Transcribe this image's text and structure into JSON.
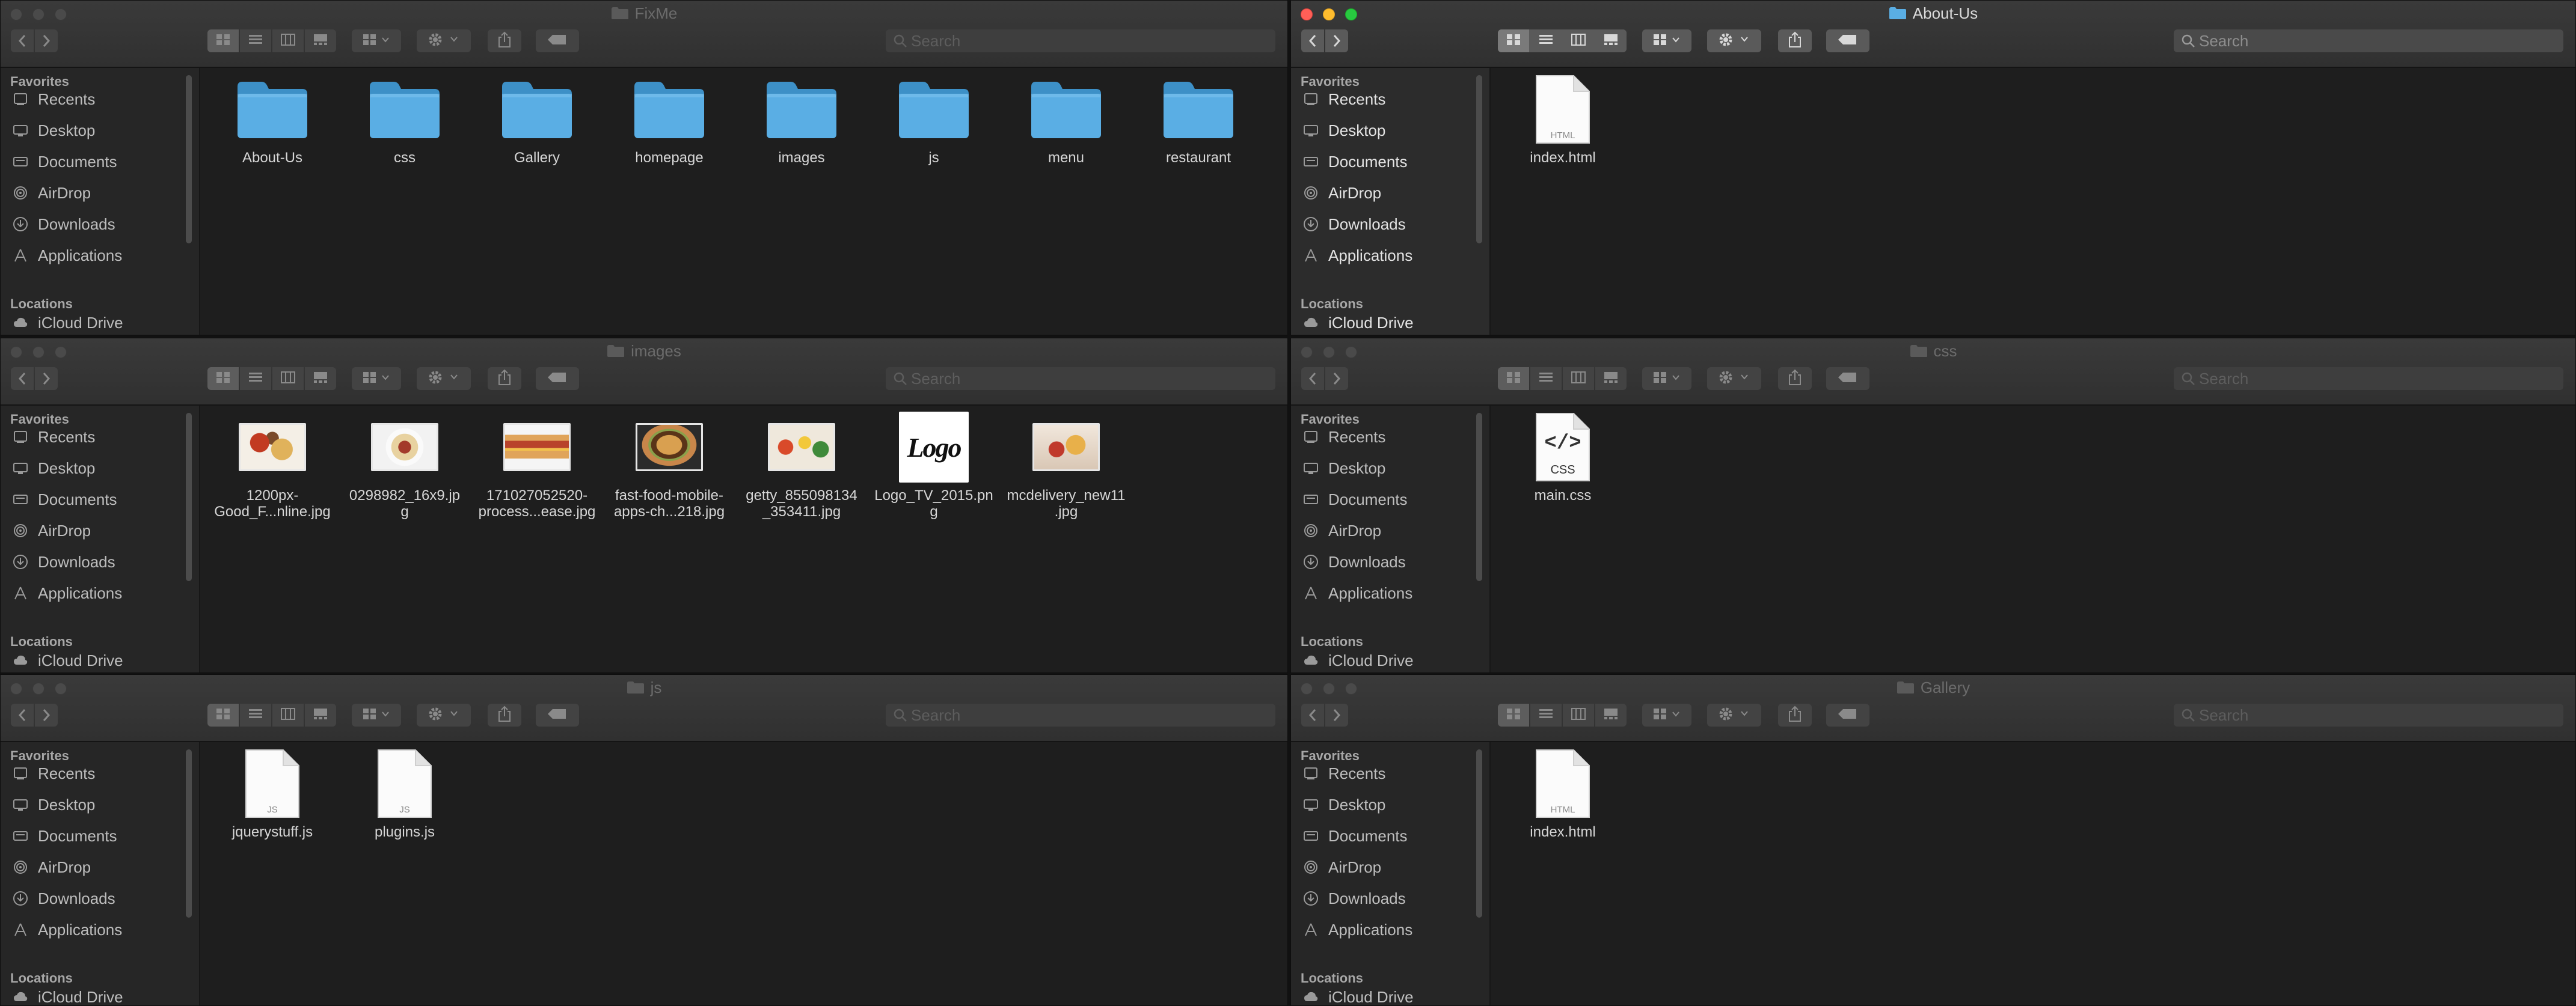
{
  "colors": {
    "folder": "#5aaee4",
    "folder_dark": "#3d90c7",
    "accent_red": "#ff5f57",
    "accent_yellow": "#febc2e",
    "accent_green": "#28c840"
  },
  "sidebar": {
    "favorites_label": "Favorites",
    "locations_label": "Locations",
    "items": [
      {
        "label": "Recents",
        "icon": "recents-icon"
      },
      {
        "label": "Desktop",
        "icon": "desktop-icon"
      },
      {
        "label": "Documents",
        "icon": "documents-icon"
      },
      {
        "label": "AirDrop",
        "icon": "airdrop-icon"
      },
      {
        "label": "Downloads",
        "icon": "downloads-icon"
      },
      {
        "label": "Applications",
        "icon": "applications-icon"
      }
    ],
    "icloud_label": "iCloud Drive"
  },
  "search_placeholder": "Search",
  "windows": [
    {
      "title": "FixMe",
      "active": false,
      "items": [
        {
          "label": "About-Us",
          "kind": "folder"
        },
        {
          "label": "css",
          "kind": "folder"
        },
        {
          "label": "Gallery",
          "kind": "folder"
        },
        {
          "label": "homepage",
          "kind": "folder"
        },
        {
          "label": "images",
          "kind": "folder"
        },
        {
          "label": "js",
          "kind": "folder"
        },
        {
          "label": "menu",
          "kind": "folder"
        },
        {
          "label": "restaurant",
          "kind": "folder"
        }
      ]
    },
    {
      "title": "About-Us",
      "active": true,
      "items": [
        {
          "label": "index.html",
          "kind": "html",
          "badge": "HTML"
        }
      ]
    },
    {
      "title": "images",
      "active": false,
      "items": [
        {
          "label": "1200px-\nGood_F...nline.jpg",
          "kind": "image",
          "thumb": "food-platter"
        },
        {
          "label": "0298982_16x9.jp\ng",
          "kind": "image",
          "thumb": "plate"
        },
        {
          "label": "171027052520-\nprocess...ease.jpg",
          "kind": "image",
          "thumb": "hotdog"
        },
        {
          "label": "fast-food-mobile-\napps-ch...218.jpg",
          "kind": "image",
          "thumb": "burger"
        },
        {
          "label": "getty_855098134\n_353411.jpg",
          "kind": "image",
          "thumb": "spread"
        },
        {
          "label": "Logo_TV_2015.pn\ng",
          "kind": "image",
          "thumb": "logo",
          "logo_text": "Logo"
        },
        {
          "label": "mcdelivery_new11\n.jpg",
          "kind": "image",
          "thumb": "mcdelivery"
        }
      ]
    },
    {
      "title": "css",
      "active": false,
      "items": [
        {
          "label": "main.css",
          "kind": "css",
          "badge": "CSS"
        }
      ]
    },
    {
      "title": "js",
      "active": false,
      "items": [
        {
          "label": "jquerystuff.js",
          "kind": "js",
          "badge": "JS"
        },
        {
          "label": "plugins.js",
          "kind": "js",
          "badge": "JS"
        }
      ]
    },
    {
      "title": "Gallery",
      "active": false,
      "items": [
        {
          "label": "index.html",
          "kind": "html",
          "badge": "HTML"
        }
      ]
    }
  ]
}
